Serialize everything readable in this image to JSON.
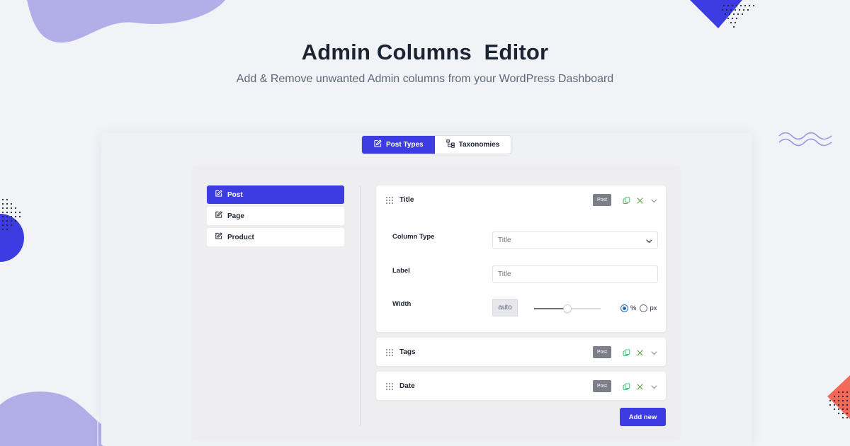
{
  "hero": {
    "title": "Admin Columns  Editor",
    "subtitle": "Add & Remove unwanted Admin columns from your WordPress Dashboard"
  },
  "tabs": [
    {
      "label": "Post Types",
      "icon": "edit-icon",
      "active": true
    },
    {
      "label": "Taxonomies",
      "icon": "hierarchy-icon",
      "active": false
    }
  ],
  "sidebar": {
    "items": [
      {
        "label": "Post",
        "icon": "edit-icon",
        "active": true
      },
      {
        "label": "Page",
        "icon": "edit-icon",
        "active": false
      },
      {
        "label": "Product",
        "icon": "edit-icon",
        "active": false
      }
    ]
  },
  "columns": [
    {
      "title": "Title",
      "badge": "Post",
      "expanded": true,
      "fields": {
        "column_type_label": "Column Type",
        "column_type_value": "Title",
        "label_label": "Label",
        "label_placeholder": "Title",
        "width_label": "Width",
        "width_value": "auto",
        "width_slider_fraction": 0.5,
        "units": [
          {
            "label": "%",
            "checked": true
          },
          {
            "label": "px",
            "checked": false
          }
        ]
      }
    },
    {
      "title": "Tags",
      "badge": "Post",
      "expanded": false
    },
    {
      "title": "Date",
      "badge": "Post",
      "expanded": false
    }
  ],
  "actions": {
    "add_new_label": "Add new"
  },
  "colors": {
    "accent": "#3c3ce2",
    "copy_icon": "#3fbf6a",
    "remove_icon": "#6aa84f",
    "blob": "#b1aee8",
    "coral": "#f26a5a"
  }
}
